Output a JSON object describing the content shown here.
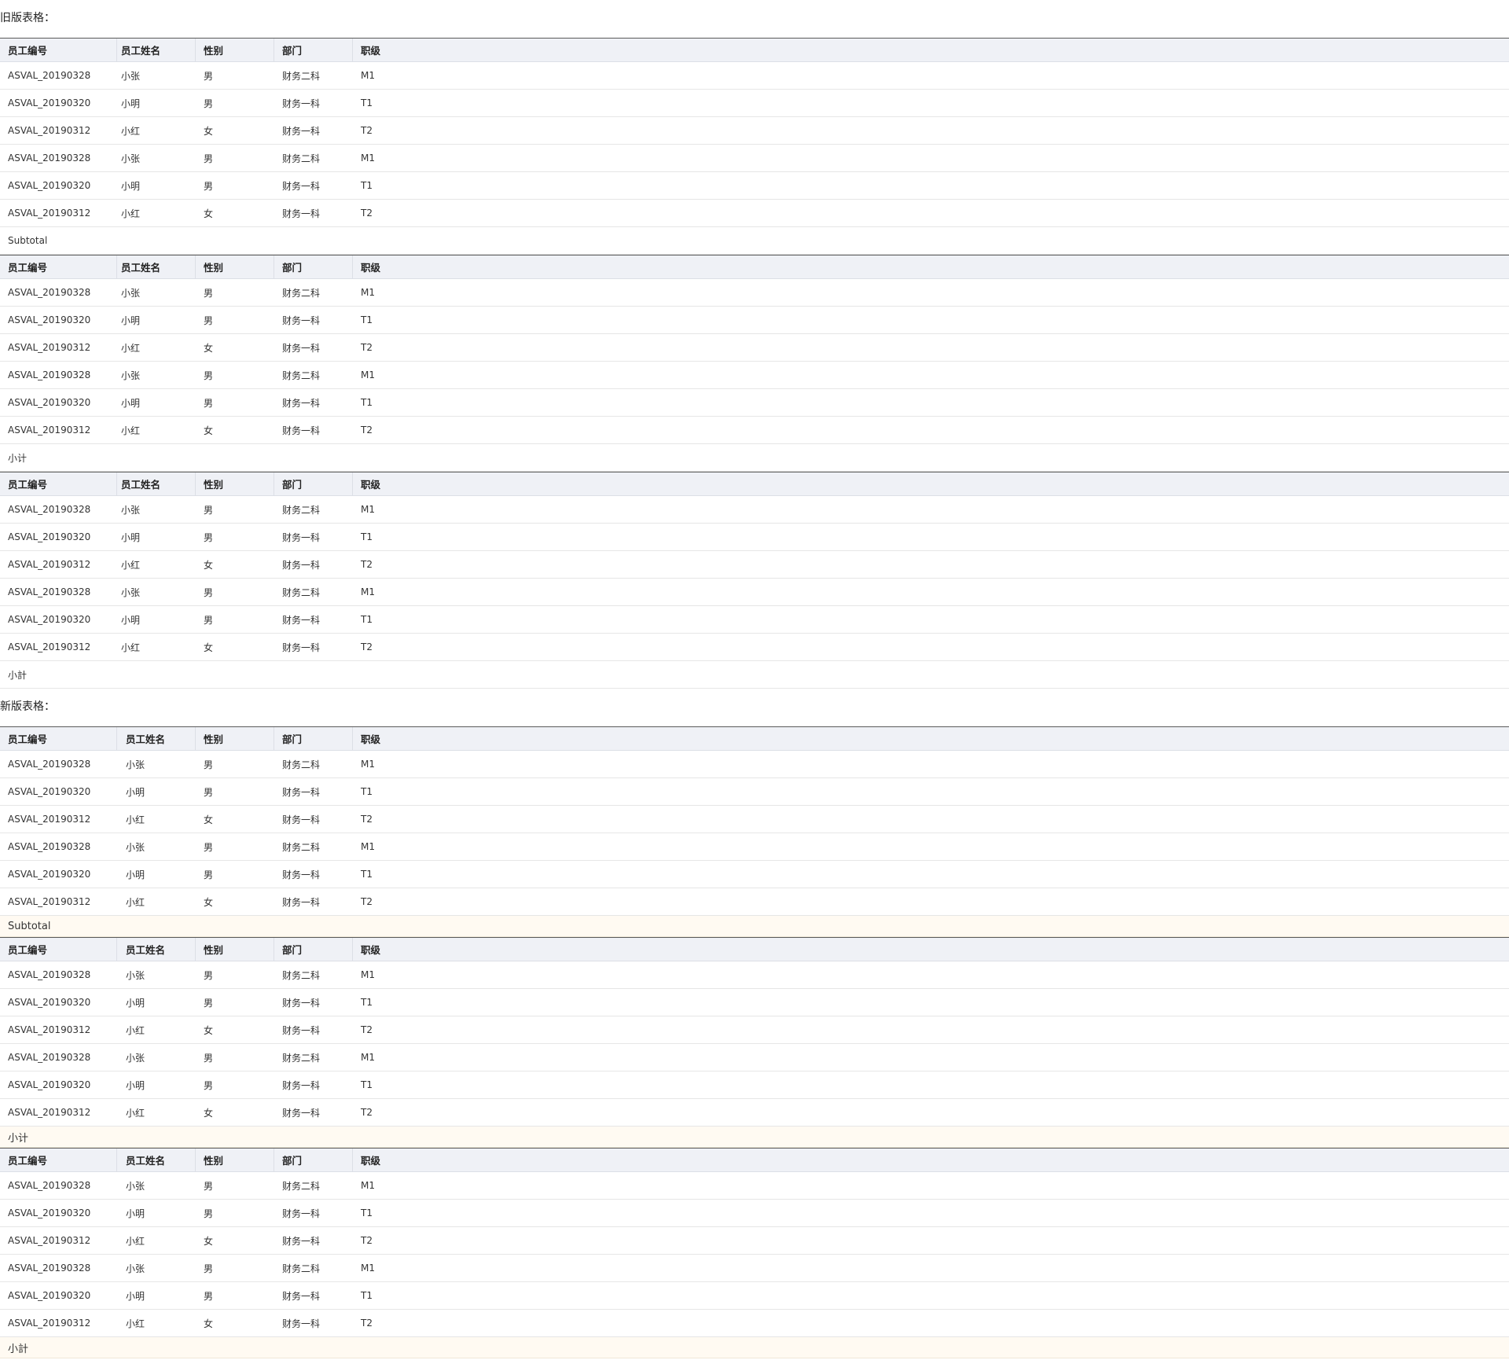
{
  "old": {
    "title": "旧版表格：",
    "headers": [
      "员工编号",
      "员工姓名",
      "性别",
      "部门",
      "职级"
    ],
    "tables": [
      {
        "rows": [
          [
            "ASVAL_20190328",
            "小张",
            "男",
            "财务二科",
            "M1"
          ],
          [
            "ASVAL_20190320",
            "小明",
            "男",
            "财务一科",
            "T1"
          ],
          [
            "ASVAL_20190312",
            "小红",
            "女",
            "财务一科",
            "T2"
          ],
          [
            "ASVAL_20190328",
            "小张",
            "男",
            "财务二科",
            "M1"
          ],
          [
            "ASVAL_20190320",
            "小明",
            "男",
            "财务一科",
            "T1"
          ],
          [
            "ASVAL_20190312",
            "小红",
            "女",
            "财务一科",
            "T2"
          ]
        ],
        "subtotal": "Subtotal"
      },
      {
        "rows": [
          [
            "ASVAL_20190328",
            "小张",
            "男",
            "财务二科",
            "M1"
          ],
          [
            "ASVAL_20190320",
            "小明",
            "男",
            "财务一科",
            "T1"
          ],
          [
            "ASVAL_20190312",
            "小红",
            "女",
            "财务一科",
            "T2"
          ],
          [
            "ASVAL_20190328",
            "小张",
            "男",
            "财务二科",
            "M1"
          ],
          [
            "ASVAL_20190320",
            "小明",
            "男",
            "财务一科",
            "T1"
          ],
          [
            "ASVAL_20190312",
            "小红",
            "女",
            "财务一科",
            "T2"
          ]
        ],
        "subtotal": "小计"
      },
      {
        "rows": [
          [
            "ASVAL_20190328",
            "小张",
            "男",
            "财务二科",
            "M1"
          ],
          [
            "ASVAL_20190320",
            "小明",
            "男",
            "财务一科",
            "T1"
          ],
          [
            "ASVAL_20190312",
            "小红",
            "女",
            "财务一科",
            "T2"
          ],
          [
            "ASVAL_20190328",
            "小张",
            "男",
            "财务二科",
            "M1"
          ],
          [
            "ASVAL_20190320",
            "小明",
            "男",
            "财务一科",
            "T1"
          ],
          [
            "ASVAL_20190312",
            "小红",
            "女",
            "财务一科",
            "T2"
          ]
        ],
        "subtotal": "小計"
      }
    ]
  },
  "new": {
    "title": "新版表格：",
    "headers": [
      "员工编号",
      "员工姓名",
      "性别",
      "部门",
      "职级"
    ],
    "tables": [
      {
        "rows": [
          [
            "ASVAL_20190328",
            "小张",
            "男",
            "财务二科",
            "M1"
          ],
          [
            "ASVAL_20190320",
            "小明",
            "男",
            "财务一科",
            "T1"
          ],
          [
            "ASVAL_20190312",
            "小红",
            "女",
            "财务一科",
            "T2"
          ],
          [
            "ASVAL_20190328",
            "小张",
            "男",
            "财务二科",
            "M1"
          ],
          [
            "ASVAL_20190320",
            "小明",
            "男",
            "财务一科",
            "T1"
          ],
          [
            "ASVAL_20190312",
            "小红",
            "女",
            "财务一科",
            "T2"
          ]
        ],
        "subtotal": "Subtotal"
      },
      {
        "rows": [
          [
            "ASVAL_20190328",
            "小张",
            "男",
            "财务二科",
            "M1"
          ],
          [
            "ASVAL_20190320",
            "小明",
            "男",
            "财务一科",
            "T1"
          ],
          [
            "ASVAL_20190312",
            "小红",
            "女",
            "财务一科",
            "T2"
          ],
          [
            "ASVAL_20190328",
            "小张",
            "男",
            "财务二科",
            "M1"
          ],
          [
            "ASVAL_20190320",
            "小明",
            "男",
            "财务一科",
            "T1"
          ],
          [
            "ASVAL_20190312",
            "小红",
            "女",
            "财务一科",
            "T2"
          ]
        ],
        "subtotal": "小计"
      },
      {
        "rows": [
          [
            "ASVAL_20190328",
            "小张",
            "男",
            "财务二科",
            "M1"
          ],
          [
            "ASVAL_20190320",
            "小明",
            "男",
            "财务一科",
            "T1"
          ],
          [
            "ASVAL_20190312",
            "小红",
            "女",
            "财务一科",
            "T2"
          ],
          [
            "ASVAL_20190328",
            "小张",
            "男",
            "财务二科",
            "M1"
          ],
          [
            "ASVAL_20190320",
            "小明",
            "男",
            "财务一科",
            "T1"
          ],
          [
            "ASVAL_20190312",
            "小红",
            "女",
            "财务一科",
            "T2"
          ]
        ],
        "subtotal": "小計"
      }
    ]
  }
}
